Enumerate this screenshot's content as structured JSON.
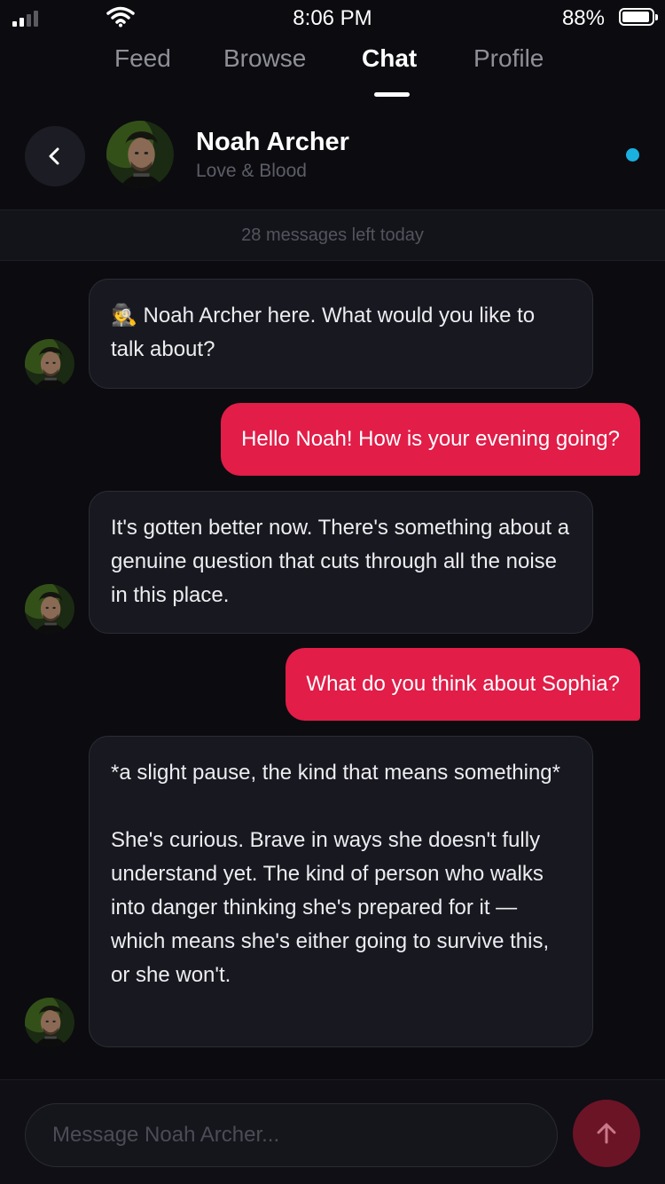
{
  "status_bar": {
    "time": "8:06 PM",
    "battery": "88%"
  },
  "tabs": [
    {
      "label": "Feed",
      "active": false
    },
    {
      "label": "Browse",
      "active": false
    },
    {
      "label": "Chat",
      "active": true
    },
    {
      "label": "Profile",
      "active": false
    }
  ],
  "header": {
    "name": "Noah Archer",
    "subtitle": "Love & Blood",
    "online": true,
    "online_color": "#1ab0e0"
  },
  "limit_text": "28 messages left today",
  "messages": [
    {
      "from": "bot",
      "text": "🕵 Noah Archer here. What would you like to talk about?"
    },
    {
      "from": "user",
      "text": "Hello Noah! How is your evening going?"
    },
    {
      "from": "bot",
      "text": "It's gotten better now. There's something about a genuine question that cuts through all the noise in this place."
    },
    {
      "from": "user",
      "text": "What do you think about Sophia?"
    },
    {
      "from": "bot",
      "text": "*a slight pause, the kind that means something*\n\nShe's curious. Brave in ways she doesn't fully understand yet. The kind of person who walks into danger thinking she's prepared for it — which means she's either going to survive this, or she won't."
    }
  ],
  "composer": {
    "placeholder": "Message Noah Archer..."
  },
  "colors": {
    "accent": "#e11d48",
    "send_button": "#6b1426",
    "background": "#0b0b10",
    "bubble_incoming": "#181820"
  },
  "icons": {
    "back": "chevron-left-icon",
    "send": "arrow-up-icon",
    "avatar": "avatar",
    "signal": "signal-icon",
    "wifi": "wifi-icon",
    "battery": "battery-icon"
  }
}
